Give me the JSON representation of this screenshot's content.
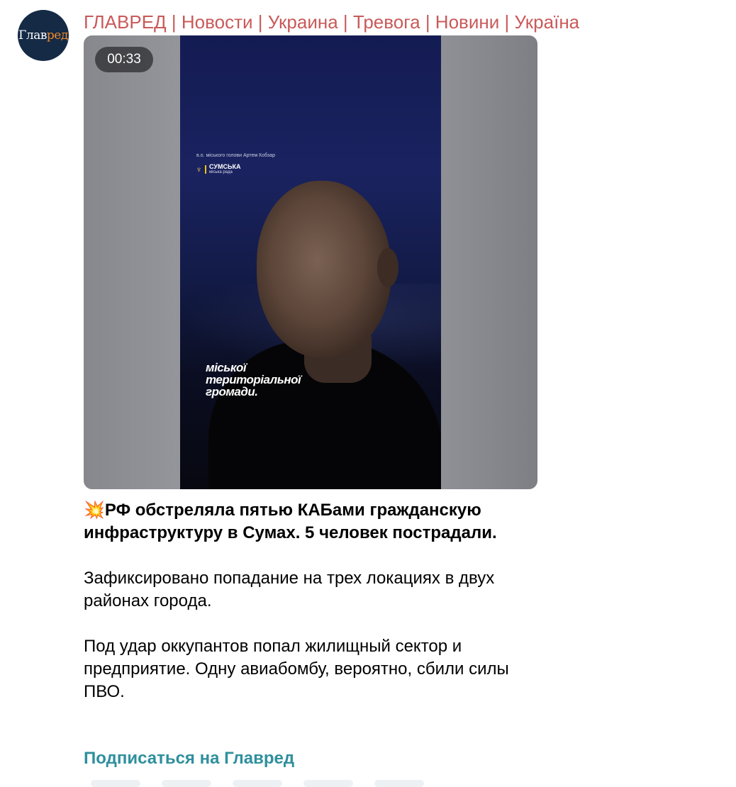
{
  "channel": {
    "avatar_text_main": "Глав",
    "avatar_text_accent": "ред",
    "title": "ГЛАВРЕД | Новости | Украина | Тревога | Новини | Україна"
  },
  "video": {
    "duration": "00:33",
    "frame_caption": "в.о. міського голови Артем Кобзар",
    "logo_line1": "СУМСЬКА",
    "logo_line2": "міська рада",
    "subtitle_lines": [
      "міської",
      "територіальної",
      "громади."
    ]
  },
  "message": {
    "emoji": "💥",
    "headline": "РФ обстреляла  пятью КАБами гражданскую инфраструктуру в Сумах. 5 человек пострадали.",
    "paragraph1": "Зафиксировано попадание на трех локациях в двух районах города.",
    "paragraph2": "Под удар оккупантов попал жилищный сектор и предприятие. Одну авиабомбу, вероятно, сбили силы ПВО."
  },
  "subscribe_link": "Подписаться на Главред",
  "colors": {
    "title": "#c95a5a",
    "link": "#2f8f9d",
    "avatar_bg": "#142a45",
    "avatar_accent": "#f08a2b"
  }
}
